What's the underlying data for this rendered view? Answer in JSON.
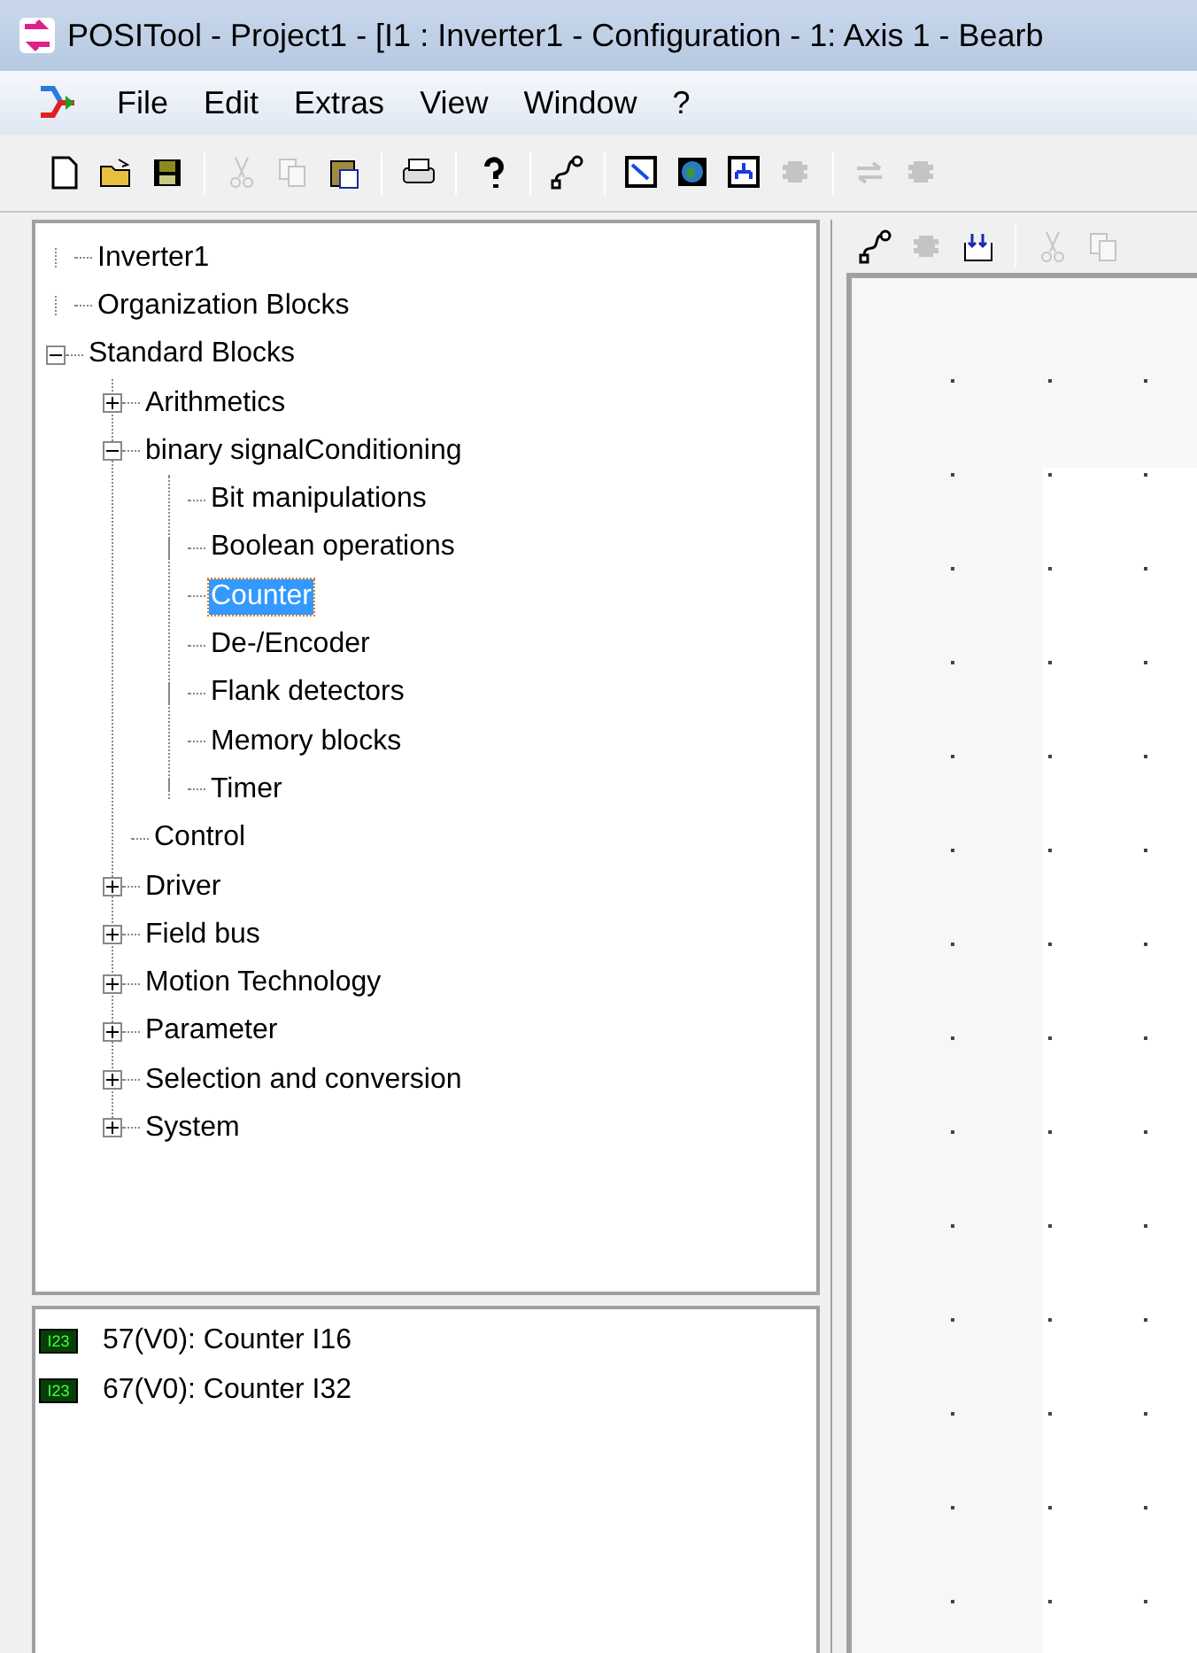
{
  "window": {
    "title": "POSITool - Project1 - [I1 : Inverter1 - Configuration - 1: Axis 1 - Bearb"
  },
  "menu": [
    {
      "label": "File"
    },
    {
      "label": "Edit"
    },
    {
      "label": "Extras"
    },
    {
      "label": "View"
    },
    {
      "label": "Window"
    },
    {
      "label": "?"
    }
  ],
  "toolbar": [
    {
      "kind": "new",
      "disabled": false
    },
    {
      "kind": "open",
      "disabled": false
    },
    {
      "kind": "save",
      "disabled": false
    },
    {
      "kind": "sep"
    },
    {
      "kind": "cut",
      "disabled": true
    },
    {
      "kind": "copy",
      "disabled": true
    },
    {
      "kind": "paste",
      "disabled": false
    },
    {
      "kind": "sep"
    },
    {
      "kind": "print",
      "disabled": false
    },
    {
      "kind": "sep"
    },
    {
      "kind": "help",
      "disabled": false
    },
    {
      "kind": "sep"
    },
    {
      "kind": "plug",
      "disabled": false
    },
    {
      "kind": "sep"
    },
    {
      "kind": "wizard",
      "disabled": false
    },
    {
      "kind": "globe",
      "disabled": false
    },
    {
      "kind": "network",
      "disabled": false
    },
    {
      "kind": "chip",
      "disabled": true
    },
    {
      "kind": "sep"
    },
    {
      "kind": "arrows",
      "disabled": true
    },
    {
      "kind": "chip",
      "disabled": true
    }
  ],
  "tree": [
    {
      "label": "Inverter1",
      "selected": false
    },
    {
      "label": "Organization Blocks",
      "selected": false
    },
    {
      "label": "Standard Blocks",
      "selected": false,
      "expanded": true,
      "children": [
        {
          "label": "Arithmetics",
          "selected": false,
          "expanded": false
        },
        {
          "label": "binary signalConditioning",
          "selected": false,
          "expanded": true,
          "children": [
            {
              "label": "Bit manipulations",
              "selected": false
            },
            {
              "label": "Boolean operations",
              "selected": false
            },
            {
              "label": "Counter",
              "selected": true
            },
            {
              "label": "De-/Encoder",
              "selected": false
            },
            {
              "label": "Flank detectors",
              "selected": false
            },
            {
              "label": "Memory blocks",
              "selected": false
            },
            {
              "label": "Timer",
              "selected": false
            }
          ]
        },
        {
          "label": "Control",
          "selected": false
        },
        {
          "label": "Driver",
          "selected": false,
          "expanded": false
        },
        {
          "label": "Field bus",
          "selected": false,
          "expanded": false
        },
        {
          "label": "Motion Technology",
          "selected": false,
          "expanded": false
        },
        {
          "label": "Parameter",
          "selected": false,
          "expanded": false
        },
        {
          "label": "Selection and conversion",
          "selected": false,
          "expanded": false
        },
        {
          "label": "System",
          "selected": false,
          "expanded": false
        }
      ]
    }
  ],
  "blocks": [
    {
      "badge": "I23",
      "label": "57(V0): Counter I16"
    },
    {
      "badge": "I23",
      "label": "67(V0): Counter I32"
    }
  ],
  "editor_toolbar": [
    {
      "kind": "plug",
      "disabled": false
    },
    {
      "kind": "chip",
      "disabled": true
    },
    {
      "kind": "import",
      "disabled": false
    },
    {
      "kind": "sep"
    },
    {
      "kind": "cut",
      "disabled": true
    },
    {
      "kind": "copy",
      "disabled": true
    }
  ]
}
